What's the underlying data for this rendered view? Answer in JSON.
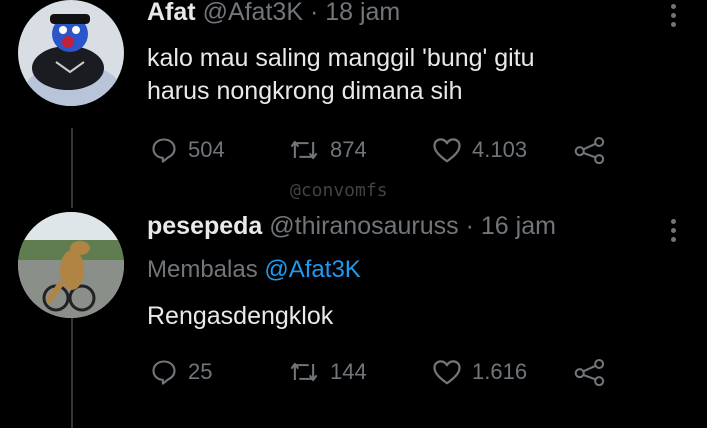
{
  "tweets": [
    {
      "name": "Afat",
      "handle": "@Afat3K",
      "time": "· 18 jam",
      "lines": [
        "kalo mau saling manggil 'bung' gitu",
        "harus nongkrong dimana sih"
      ],
      "replies": "504",
      "retweets": "874",
      "likes": "4.103"
    },
    {
      "name": "pesepeda",
      "handle": "@thiranosauruss",
      "time": "· 16 jam",
      "reply_prefix": "Membalas",
      "reply_handle": "@Afat3K",
      "lines": [
        "Rengasdengklok"
      ],
      "replies": "25",
      "retweets": "144",
      "likes": "1.616"
    }
  ],
  "watermark": "@convomfs",
  "colors": {
    "background": "#000000",
    "text": "#e7e9ea",
    "muted": "#71767b",
    "link": "#1d9bf0"
  },
  "icons": [
    "reply-icon",
    "retweet-icon",
    "like-icon",
    "share-icon",
    "more-icon"
  ]
}
